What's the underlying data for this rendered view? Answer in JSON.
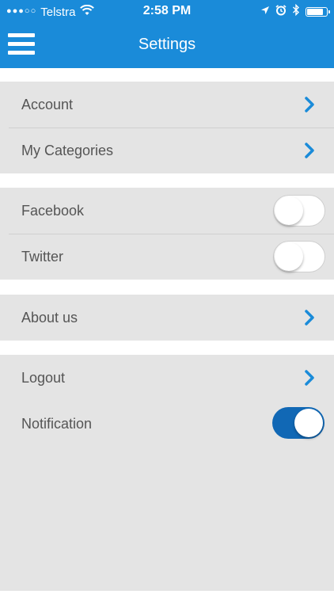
{
  "status_bar": {
    "carrier": "Telstra",
    "signal_dots": "●●●○○",
    "time": "2:58 PM",
    "battery_level": 0.85
  },
  "header": {
    "title": "Settings",
    "menu_icon": "hamburger-menu-icon"
  },
  "colors": {
    "header_bg": "#1a8bd9",
    "group_bg": "#e4e4e4",
    "chevron": "#1a8bd9",
    "toggle_on": "#1168b5"
  },
  "groups": [
    {
      "rows": [
        {
          "label": "Account",
          "control": "chevron"
        },
        {
          "label": "My Categories",
          "control": "chevron"
        }
      ]
    },
    {
      "rows": [
        {
          "label": "Facebook",
          "control": "toggle",
          "on": false
        },
        {
          "label": "Twitter",
          "control": "toggle",
          "on": false
        }
      ]
    },
    {
      "rows": [
        {
          "label": "About us",
          "control": "chevron"
        }
      ]
    },
    {
      "rows": [
        {
          "label": "Logout",
          "control": "chevron"
        },
        {
          "label": "Notification",
          "control": "toggle",
          "on": true
        }
      ]
    }
  ]
}
